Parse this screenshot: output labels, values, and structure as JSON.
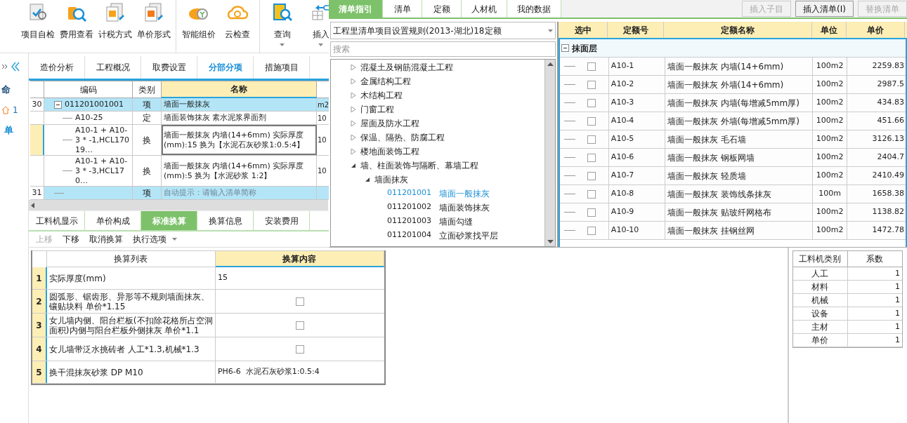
{
  "toolbar": {
    "groups": [
      [
        {
          "label": "项目自检",
          "menu": false
        },
        {
          "label": "费用查看",
          "menu": false
        },
        {
          "label": "计税方式",
          "menu": false
        },
        {
          "label": "单价形式",
          "menu": false
        }
      ],
      [
        {
          "label": "智能组价",
          "menu": false
        },
        {
          "label": "云检查",
          "menu": false
        }
      ],
      [
        {
          "label": "查询",
          "menu": true
        },
        {
          "label": "插入",
          "menu": true
        }
      ]
    ]
  },
  "sidebar": {
    "title": "命",
    "items": [
      {
        "label": "1",
        "kind": "home"
      },
      {
        "label": "单",
        "kind": "text"
      }
    ]
  },
  "tabs": [
    {
      "label": "造价分析",
      "selected": false
    },
    {
      "label": "工程概况",
      "selected": false
    },
    {
      "label": "取费设置",
      "selected": false
    },
    {
      "label": "分部分项",
      "selected": true
    },
    {
      "label": "措施项目",
      "selected": false
    }
  ],
  "grid": {
    "columns": [
      "编码",
      "类别",
      "名称"
    ],
    "rows": [
      {
        "number": "30",
        "kind": "item",
        "selected": false,
        "expanded": true,
        "code": "011201001001",
        "type": "项",
        "name": "墙面一般抹灰",
        "unit": "m2"
      },
      {
        "number": "",
        "kind": "sub",
        "selected": false,
        "code": "A10-25",
        "type": "定",
        "name": "墙面装饰抹灰 素水泥浆界面剂",
        "unit": "10"
      },
      {
        "number": "",
        "kind": "sub",
        "selected": true,
        "code": "A10-1 + A10-3 * -1,HCL17019…",
        "type": "换",
        "name": "墙面一般抹灰 内墙(14+6mm) 实际厚度(mm):15 换为【水泥石灰砂浆1:0.5:4】",
        "unit": "10"
      },
      {
        "number": "",
        "kind": "sub",
        "selected": false,
        "code": "A10-1 + A10-3 * -3,HCL170…",
        "type": "换",
        "name": "墙面一般抹灰 内墙(14+6mm) 实际厚度(mm):5 换为【水泥砂浆 1:2】",
        "unit": "10"
      },
      {
        "number": "31",
        "kind": "item",
        "selected": false,
        "code": "",
        "type": "项",
        "placeholder": "自动提示：请输入清单简称"
      }
    ]
  },
  "bottom_tabs": [
    {
      "label": "工料机显示",
      "selected": false
    },
    {
      "label": "单价构成",
      "selected": false
    },
    {
      "label": "标准换算",
      "selected": true
    },
    {
      "label": "换算信息",
      "selected": false
    },
    {
      "label": "安装费用",
      "selected": false
    }
  ],
  "bottom_toolbar": [
    {
      "label": "上移",
      "disabled": true,
      "menu": false
    },
    {
      "label": "下移",
      "disabled": false,
      "menu": false
    },
    {
      "label": "取消换算",
      "disabled": false,
      "menu": false
    },
    {
      "label": "执行选项",
      "disabled": false,
      "menu": true
    }
  ],
  "conversion_table": {
    "columns": [
      "换算列表",
      "换算内容"
    ],
    "rows": [
      {
        "number": "1",
        "label": "实际厚度(mm)",
        "kind": "text",
        "value": "15"
      },
      {
        "number": "2",
        "label": "圆弧形、锯齿形、异形等不规则墙面抹灰、镶贴块料 单价*1.15",
        "kind": "checkbox",
        "checked": false
      },
      {
        "number": "3",
        "label": "女儿墙内侧、阳台栏板(不扣除花格所占空洞面积)内侧与阳台栏板外侧抹灰 单价*1.1",
        "kind": "checkbox",
        "checked": false
      },
      {
        "number": "4",
        "label": "女儿墙带泛水挑砖者 人工*1.3,机械*1.3",
        "kind": "checkbox",
        "checked": false
      },
      {
        "number": "5",
        "label": "换干混抹灰砂浆 DP M10",
        "kind": "text",
        "value": "PH6-6  水泥石灰砂浆1:0.5:4"
      }
    ]
  },
  "coefficient_table": {
    "columns": [
      "工料机类别",
      "系数"
    ],
    "rows": [
      {
        "category": "人工",
        "value": "1"
      },
      {
        "category": "材料",
        "value": "1"
      },
      {
        "category": "机械",
        "value": "1"
      },
      {
        "category": "设备",
        "value": "1"
      },
      {
        "category": "主材",
        "value": "1"
      },
      {
        "category": "单价",
        "value": "1"
      }
    ]
  },
  "guide_panel": {
    "tabs": [
      {
        "label": "清单指引",
        "selected": true
      },
      {
        "label": "清单",
        "selected": false
      },
      {
        "label": "定额",
        "selected": false
      },
      {
        "label": "人材机",
        "selected": false
      },
      {
        "label": "我的数据",
        "selected": false
      }
    ],
    "buttons": [
      {
        "label": "插入子目",
        "disabled": true
      },
      {
        "label": "插入清单(I)",
        "disabled": false
      },
      {
        "label": "替换清单",
        "disabled": true
      }
    ],
    "rule_select": {
      "value": "工程里清单项目设置规则(2013-湖北)18定额"
    },
    "search": {
      "placeholder": "搜索"
    },
    "tree": [
      {
        "label": "混凝土及钢筋混凝土工程",
        "expanded": false
      },
      {
        "label": "金属结构工程",
        "expanded": false
      },
      {
        "label": "木结构工程",
        "expanded": false
      },
      {
        "label": "门窗工程",
        "expanded": false
      },
      {
        "label": "屋面及防水工程",
        "expanded": false
      },
      {
        "label": "保温、隔热、防腐工程",
        "expanded": false
      },
      {
        "label": "楼地面装饰工程",
        "expanded": false
      },
      {
        "label": "墙、柱面装饰与隔断、幕墙工程",
        "expanded": true,
        "children": [
          {
            "label": "墙面抹灰",
            "expanded": true,
            "children": [
              {
                "code": "011201001",
                "label": "墙面一般抹灰",
                "selected": true
              },
              {
                "code": "011201002",
                "label": "墙面装饰抹灰",
                "selected": false
              },
              {
                "code": "011201003",
                "label": "墙面勾缝",
                "selected": false
              },
              {
                "code": "011201004",
                "label": "立面砂浆找平层",
                "selected": false
              }
            ]
          }
        ]
      }
    ],
    "quota_table": {
      "columns": [
        "选中",
        "定额号",
        "定额名称",
        "单位",
        "单价"
      ],
      "group": {
        "label": "抹面层",
        "expanded": true
      },
      "rows": [
        {
          "checked": false,
          "code": "A10-1",
          "name": "墙面一般抹灰 内墙(14+6mm)",
          "unit": "100m2",
          "price": "2259.83"
        },
        {
          "checked": false,
          "code": "A10-2",
          "name": "墙面一般抹灰 外墙(14+6mm)",
          "unit": "100m2",
          "price": "2987.5"
        },
        {
          "checked": false,
          "code": "A10-3",
          "name": "墙面一般抹灰 内墙(每增减5mm厚)",
          "unit": "100m2",
          "price": "434.83"
        },
        {
          "checked": false,
          "code": "A10-4",
          "name": "墙面一般抹灰 外墙(每增减5mm厚)",
          "unit": "100m2",
          "price": "451.66"
        },
        {
          "checked": false,
          "code": "A10-5",
          "name": "墙面一般抹灰 毛石墙",
          "unit": "100m2",
          "price": "3126.13"
        },
        {
          "checked": false,
          "code": "A10-6",
          "name": "墙面一般抹灰 钢板网墙",
          "unit": "100m2",
          "price": "2404.7"
        },
        {
          "checked": false,
          "code": "A10-7",
          "name": "墙面一般抹灰 轻质墙",
          "unit": "100m2",
          "price": "2410.49"
        },
        {
          "checked": false,
          "code": "A10-8",
          "name": "墙面一般抹灰 装饰线条抹灰",
          "unit": "100m",
          "price": "1658.38"
        },
        {
          "checked": false,
          "code": "A10-9",
          "name": "墙面一般抹灰 贴玻纤网格布",
          "unit": "100m2",
          "price": "1138.82"
        },
        {
          "checked": false,
          "code": "A10-10",
          "name": "墙面一般抹灰 挂钢丝网",
          "unit": "100m2",
          "price": "1472.78"
        }
      ]
    }
  }
}
